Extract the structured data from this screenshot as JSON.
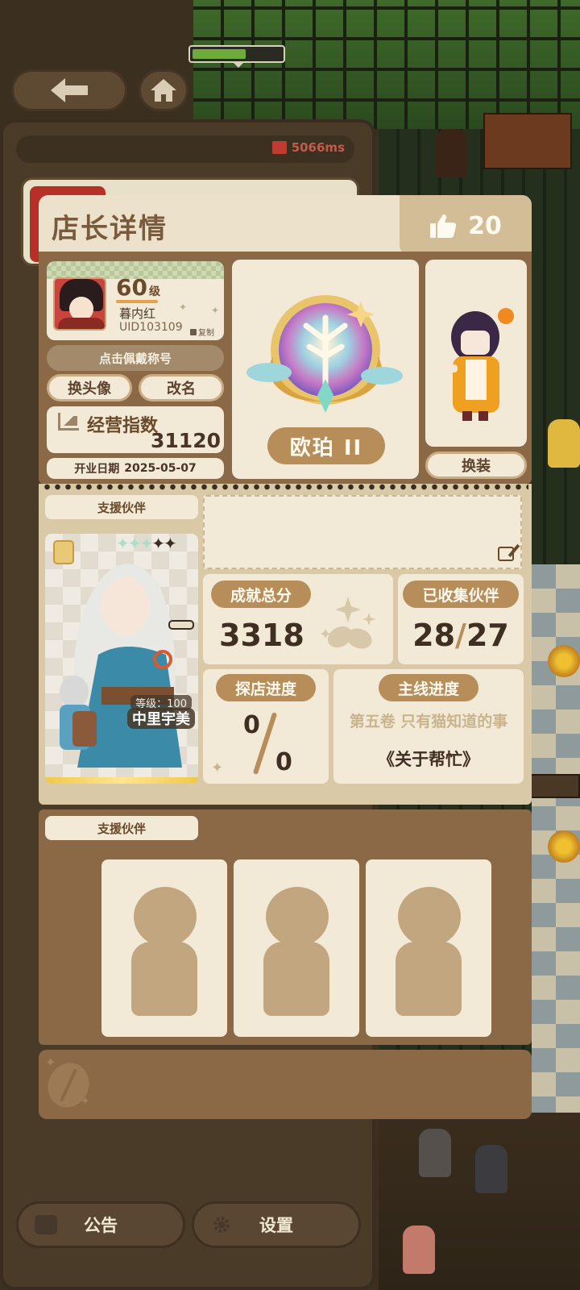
{
  "ping": {
    "text": "5066ms"
  },
  "modal": {
    "title": "店长详情",
    "likes": "20"
  },
  "profile": {
    "level": "60",
    "level_unit": "级",
    "name": "暮内红",
    "uid": "UID103109",
    "copy_label": "复制",
    "wear_title_label": "点击佩戴称号",
    "change_avatar_label": "换头像",
    "rename_label": "改名",
    "business_index_label": "经营指数",
    "business_index_value": "31120",
    "open_date_label": "开业日期",
    "open_date_value": "2025-05-07"
  },
  "badge": {
    "name": "欧珀 II"
  },
  "character": {
    "outfit_label": "换装"
  },
  "partner": {
    "section_label": "支援伙伴",
    "level_text": "等级：100",
    "name": "中里宇美",
    "stars_light": "✦✦✦",
    "stars_dark": "✦✦"
  },
  "stats": {
    "achievement_label": "成就总分",
    "achievement_value": "3318",
    "collected_label": "已收集伙伴",
    "collected_value": "28",
    "collected_total": "27",
    "explore_label": "探店进度",
    "explore_current": "0",
    "explore_total": "0",
    "main_label": "主线进度",
    "main_volume": "第五卷 只有猫知道的事",
    "main_chapter": "《关于帮忙》"
  },
  "support": {
    "section_label": "支援伙伴",
    "slots": [
      "",
      "",
      ""
    ]
  },
  "bottom": {
    "notice_label": "公告",
    "settings_label": "设置"
  },
  "colors": {
    "panel_brown": "#8b6946",
    "cream": "#f2ead6",
    "pill_tan": "#b78d5a",
    "title_text": "#7a5a3c"
  }
}
